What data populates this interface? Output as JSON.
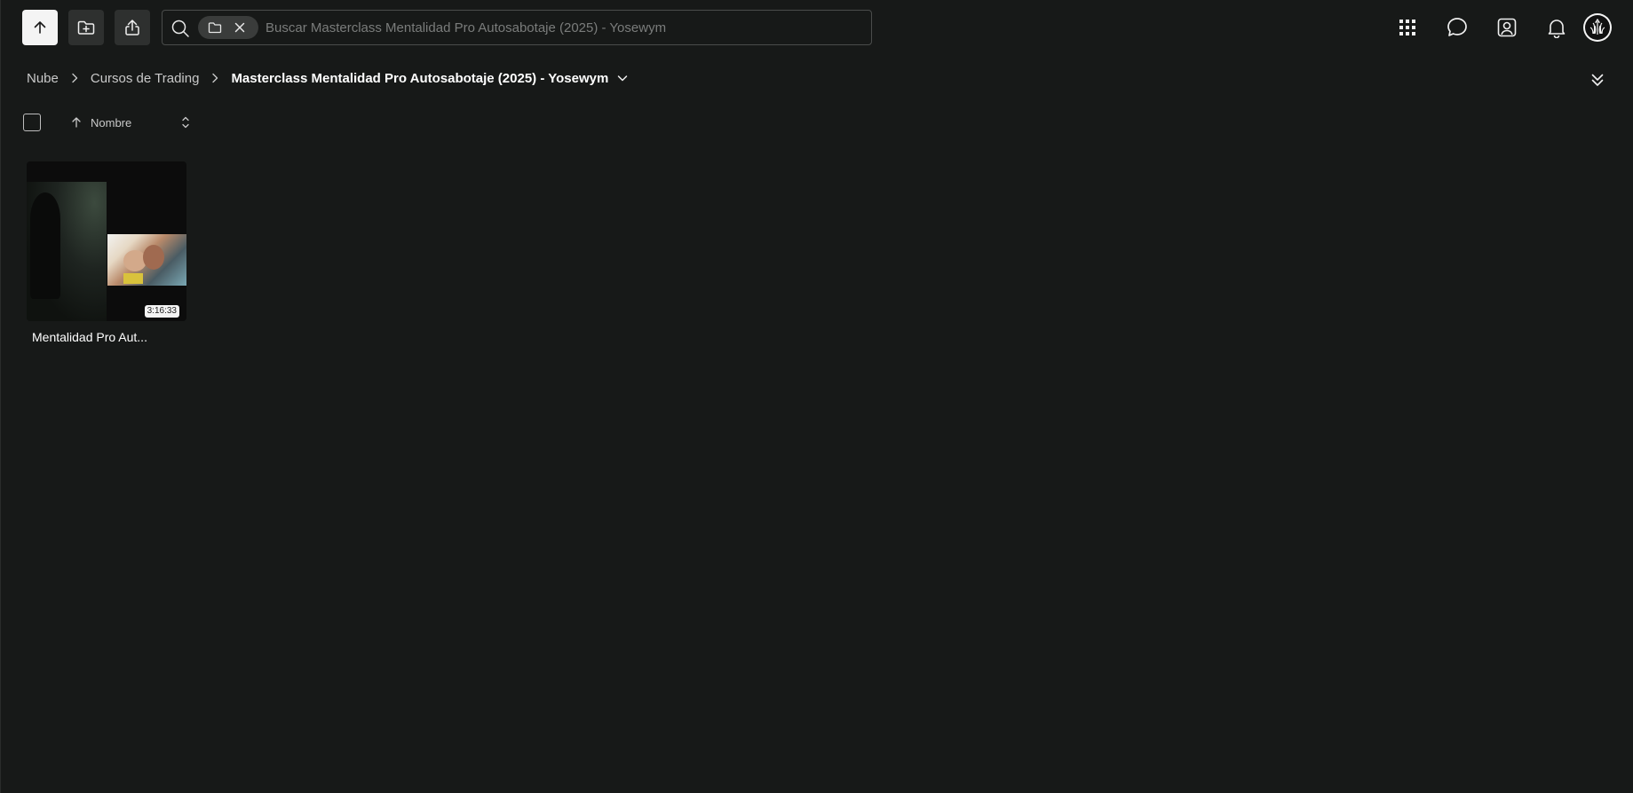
{
  "topbar": {
    "upload_icon": "arrow-up-icon",
    "new_folder_icon": "folder-plus-icon",
    "share_icon": "share-icon",
    "search": {
      "icon": "search-icon",
      "scope_icon": "folder-icon",
      "clear_icon": "close-icon",
      "placeholder": "Buscar Masterclass Mentalidad Pro Autosabotaje (2025) - Yosewym",
      "value": ""
    },
    "right_icons": [
      "apps-grid-icon",
      "chat-icon",
      "contacts-icon",
      "bell-icon",
      "avatar"
    ]
  },
  "breadcrumb": {
    "items": [
      "Nube",
      "Cursos de Trading",
      "Masterclass Mentalidad Pro Autosabotaje (2025) - Yosewym"
    ]
  },
  "toolbar": {
    "sort_label": "Nombre",
    "sort_direction": "ascending"
  },
  "files": [
    {
      "name": "Mentalidad Pro Aut...",
      "type": "video",
      "duration": "3:16:33"
    }
  ],
  "colors": {
    "background": "#171918",
    "button": "#2e302f",
    "primary_button": "#f4f4f4",
    "text": "#e8e8e8"
  }
}
